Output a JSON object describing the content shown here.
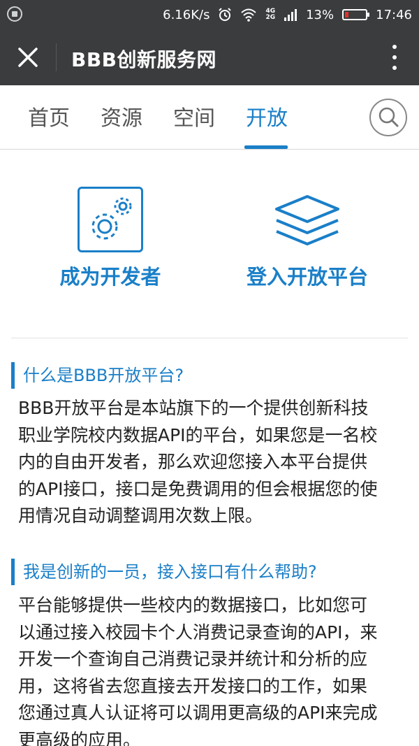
{
  "status_bar": {
    "speed": "6.16K/s",
    "alarm_icon": "alarm-icon",
    "wifi_icon": "wifi-icon",
    "network_top": "4G",
    "network_bottom": "2G",
    "battery_percent": "13%",
    "time": "17:46"
  },
  "app_bar": {
    "title": "BBB创新服务网",
    "close_icon": "close-icon",
    "more_icon": "more-vertical-icon"
  },
  "tabs": [
    {
      "label": "首页",
      "active": false
    },
    {
      "label": "资源",
      "active": false
    },
    {
      "label": "空间",
      "active": false
    },
    {
      "label": "开放",
      "active": true
    }
  ],
  "colors": {
    "accent": "#1a7fc8",
    "header_bg": "#3a3c3e",
    "battery_low": "#e0312b"
  },
  "actions": {
    "developer": {
      "label": "成为开发者",
      "icon": "gears-icon"
    },
    "platform": {
      "label": "登入开放平台",
      "icon": "layers-icon"
    }
  },
  "sections": [
    {
      "heading": "什么是BBB开放平台?",
      "lines": [
        "BBB开放平台是本站旗下的一个提供创新科技",
        "职业学院校内数据API的平台，如果您是一名校",
        "内的自由开发者，那么欢迎您接入本平台提供",
        "的API接口，接口是免费调用的但会根据您的使",
        "用情况自动调整调用次数上限。"
      ]
    },
    {
      "heading": "我是创新的一员，接入接口有什么帮助?",
      "lines": [
        "平台能够提供一些校内的数据接口，比如您可",
        "以通过接入校园卡个人消费记录查询的API，来",
        "开发一个查询自己消费记录并统计和分析的应",
        "用，这将省去您直接去开发接口的工作，如果",
        "您通过真人认证将可以调用更高级的API来完成",
        "更高级的应用。"
      ]
    }
  ]
}
